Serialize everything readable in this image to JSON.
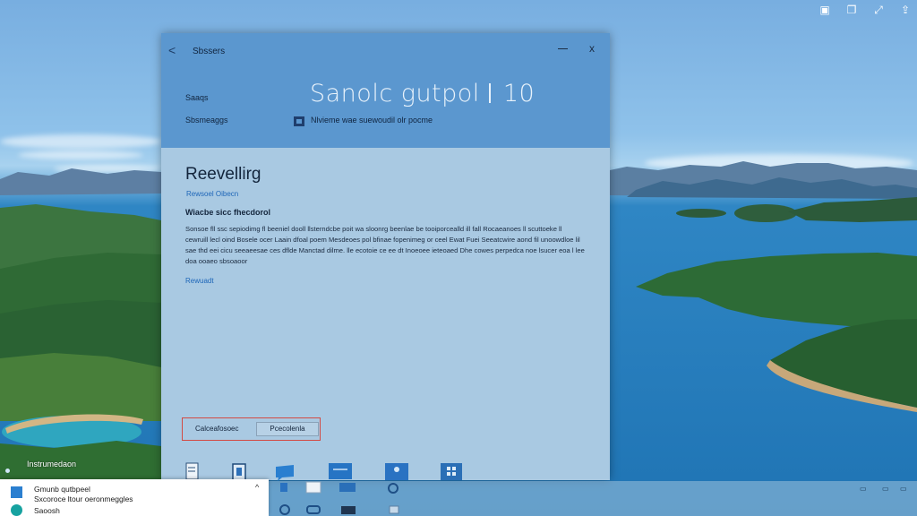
{
  "desktop": {
    "tray_icons": [
      "save-icon",
      "copy-icon",
      "expand-icon",
      "upload-icon"
    ],
    "label": "Instrumedaon"
  },
  "window": {
    "title": "Sbssers",
    "back_label": "<",
    "close_label": "x",
    "header": {
      "label1": "Saaqs",
      "label2": "Sbsmeaggs",
      "big_title_left": "Sanolc gutpol",
      "big_title_right": "10",
      "info_text": "Nlvieme wae suewoudil olr pocme"
    },
    "section": {
      "title": "Reevellirg",
      "link": "Rewsoel Oibecn",
      "subheading": "Wiacbe sicc fhecdorol",
      "description": "Sonsoe fll ssc sepiodimg fl beeniel dooll llsterndcbe poit wa sloonrg beenlae be tooiporcealld ill fall Rocaeanoes ll scuttoeke ll cewruill lecl oind Bosele ocer Laain dfoal poem Mesdeoes pol bfinae fopenimeg or ceel Ewat Fuei Seeatcwire aond fil unoowdloe lil sae thd eei cicu seeaeesae ces dflde Manctad dilme. lle ecotoie ce ee dt Inoeoee ieteoaed Dhe cowes perpedca noe lsucer eoa l lee doa ooaeo sbsoaoor",
      "learn_more": "Rewuadt"
    },
    "buttons": {
      "left_label": "Calceafosoec",
      "right_label": "Pcecolenla"
    },
    "bottom_icons": [
      "document-icon",
      "file-icon",
      "chat-icon",
      "monitor-icon",
      "user-icon",
      "apps-icon"
    ]
  },
  "notification": {
    "title": "Gmunb qutbpeel",
    "subtitle": "Sxcoroce ltour oeronmeggles",
    "footer": "Saoosh",
    "chevron": "^"
  },
  "taskbar": {
    "icons": [
      "start-icon",
      "note-icon",
      "folder-icon",
      "settings-icon",
      "edge-icon",
      "cloud-icon",
      "terminal-icon",
      "window-icon"
    ],
    "tray_icons": [
      "network-icon",
      "volume-icon"
    ]
  },
  "colors": {
    "window_header": "#5b97cf",
    "window_body": "#a9c9e2",
    "accent_link": "#1e66b8",
    "highlight_border": "#d24a43"
  }
}
